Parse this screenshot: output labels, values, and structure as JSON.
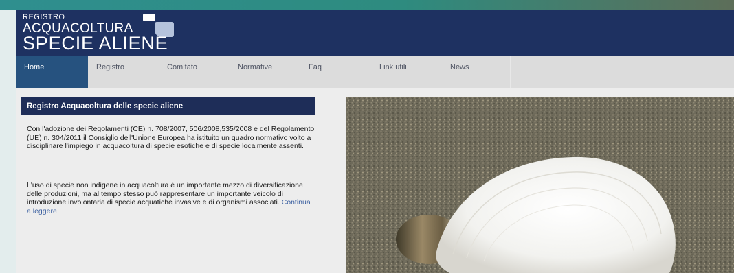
{
  "logo": {
    "line1": "REGISTRO",
    "line2": "ACQUACOLTURA",
    "line3": "SPECIE ALIENE"
  },
  "nav": {
    "items": [
      "Home",
      "Registro",
      "Comitato",
      "Normative",
      "Faq",
      "Link utili",
      "News"
    ]
  },
  "content": {
    "title": "Registro Acquacoltura delle specie aliene",
    "paragraph1": "Con l'adozione dei Regolamenti (CE) n. 708/2007, 506/2008,535/2008 e del Regolamento (UE) n. 304/2011 il Consiglio dell'Unione Europea ha istituito un quadro normativo volto a disciplinare l'impiego in acquacoltura di specie esotiche e di specie localmente assenti.",
    "paragraph2": "L'uso di specie non indigene  in acquacoltura è un importante mezzo di diversificazione delle produzioni, ma al tempo stesso  può rappresentare un importante veicolo di introduzione involontaria di specie acquatiche invasive e di organismi associati.",
    "read_more": "Continua a leggere"
  },
  "colors": {
    "header": "#1e3161",
    "nav_active": "#26527f",
    "title_bar": "#1e2d58",
    "link": "#3a5fa0"
  }
}
